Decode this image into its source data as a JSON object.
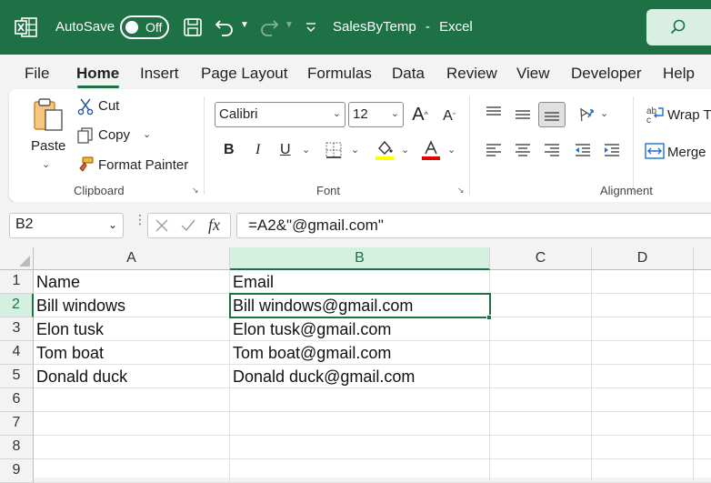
{
  "titlebar": {
    "autosave_label": "AutoSave",
    "toggle_state": "Off",
    "doc_title": "SalesByTemp",
    "separator": "-",
    "app_name": "Excel",
    "accent_color": "#1e7145"
  },
  "menu": {
    "tabs": [
      "File",
      "Home",
      "Insert",
      "Page Layout",
      "Formulas",
      "Data",
      "Review",
      "View",
      "Developer",
      "Help"
    ],
    "active": "Home"
  },
  "ribbon": {
    "clipboard": {
      "paste": "Paste",
      "cut": "Cut",
      "copy": "Copy",
      "format_painter": "Format Painter",
      "group_label": "Clipboard"
    },
    "font": {
      "font_name": "Calibri",
      "font_size": "12",
      "bold": "B",
      "italic": "I",
      "underline": "U",
      "group_label": "Font",
      "highlight_color": "#ffff00",
      "font_color": "#e00000"
    },
    "alignment": {
      "wrap_text": "Wrap T",
      "merge": "Merge",
      "group_label": "Alignment"
    }
  },
  "formula_bar": {
    "name_box": "B2",
    "fx_label": "fx",
    "formula": "=A2&\"@gmail.com\""
  },
  "grid": {
    "columns": [
      "A",
      "B",
      "C",
      "D"
    ],
    "selected_column": "B",
    "rows": [
      {
        "num": "1",
        "a": "Name",
        "b": "Email"
      },
      {
        "num": "2",
        "a": "Bill windows",
        "b": "Bill windows@gmail.com"
      },
      {
        "num": "3",
        "a": "Elon tusk",
        "b": "Elon tusk@gmail.com"
      },
      {
        "num": "4",
        "a": "Tom boat",
        "b": "Tom boat@gmail.com"
      },
      {
        "num": "5",
        "a": "Donald duck",
        "b": "Donald duck@gmail.com"
      },
      {
        "num": "6",
        "a": "",
        "b": ""
      },
      {
        "num": "7",
        "a": "",
        "b": ""
      },
      {
        "num": "8",
        "a": "",
        "b": ""
      },
      {
        "num": "9",
        "a": "",
        "b": ""
      }
    ]
  }
}
